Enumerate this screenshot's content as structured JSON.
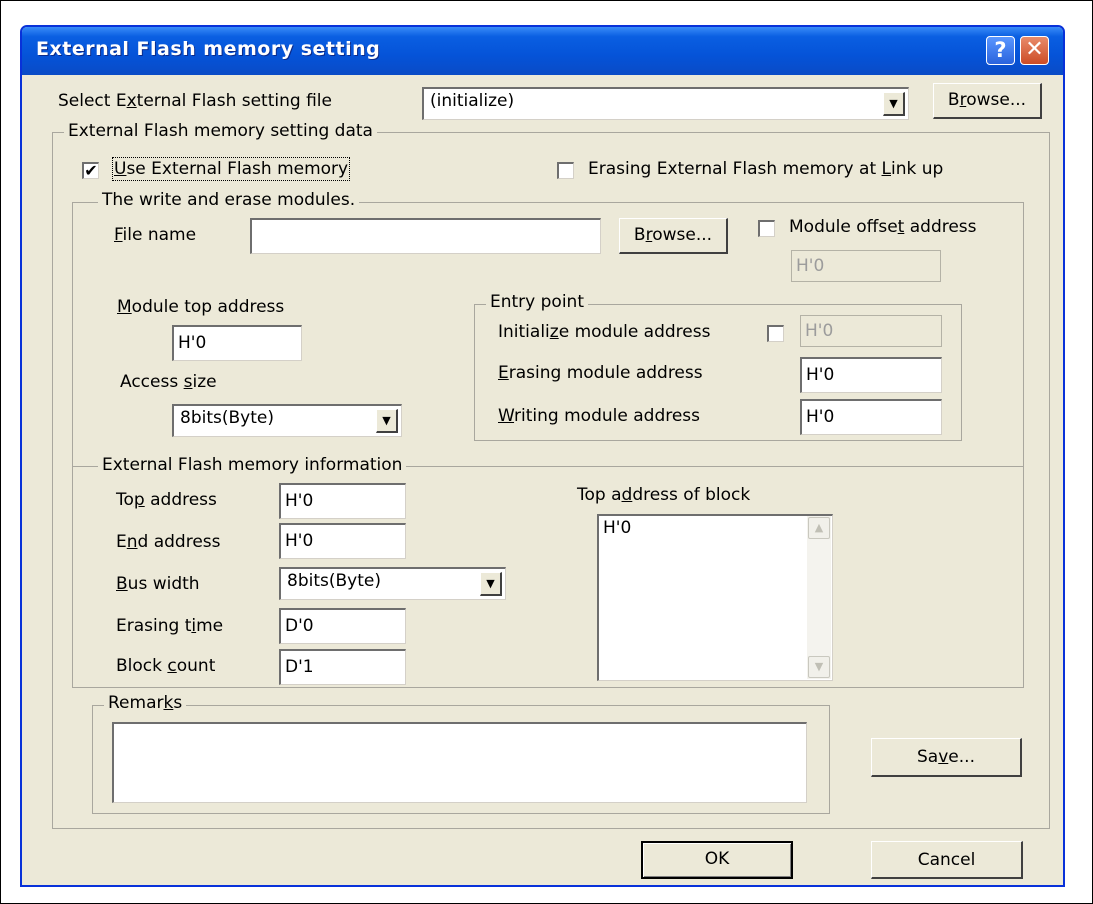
{
  "window": {
    "title": "External Flash memory setting",
    "help_glyph": "?",
    "close_glyph": "✕"
  },
  "setting_file": {
    "label_pre": "Select E",
    "label_key": "x",
    "label_post": "ternal Flash setting file",
    "value": "(initialize)",
    "browse_pre": "B",
    "browse_key": "r",
    "browse_post": "owse..."
  },
  "setting_data": {
    "group_title": "External Flash memory setting data",
    "use_flash": {
      "checked": true,
      "check_glyph": "✔",
      "label_key": "U",
      "label_post": "se External Flash memory"
    },
    "erase_at_linkup": {
      "checked": false,
      "label_pre": "Erasing External Flash memory at ",
      "label_key": "L",
      "label_post": "ink up"
    }
  },
  "modules": {
    "group_title": "The write and erase modules.",
    "file_name_key": "F",
    "file_name_post": "ile name",
    "file_name_value": "",
    "browse_pre": "B",
    "browse_key": "r",
    "browse_post": "owse...",
    "offset": {
      "checked": false,
      "label_pre": "Module offse",
      "label_key": "t",
      "label_post": " address",
      "value": "H'0"
    },
    "top_address": {
      "label_key": "M",
      "label_post": "odule top address",
      "value": "H'0"
    },
    "access_size": {
      "label_pre": "Access ",
      "label_key": "s",
      "label_post": "ize",
      "value": "8bits(Byte)"
    },
    "entry_point": {
      "group_title": "Entry point",
      "initialize": {
        "label_pre": "Initiali",
        "label_key": "z",
        "label_post": "e module address",
        "checked": false,
        "value": "H'0"
      },
      "erasing": {
        "label_key": "E",
        "label_post": "rasing module address",
        "value": "H'0"
      },
      "writing": {
        "label_key": "W",
        "label_post": "riting module address",
        "value": "H'0"
      }
    }
  },
  "info": {
    "group_title": "External Flash memory information",
    "top_address": {
      "label_pre": "To",
      "label_key": "p",
      "label_post": " address",
      "value": "H'0"
    },
    "end_address": {
      "label_pre": "E",
      "label_key": "n",
      "label_post": "d address",
      "value": "H'0"
    },
    "bus_width": {
      "label_key": "B",
      "label_post": "us width",
      "value": "8bits(Byte)"
    },
    "erasing_time": {
      "label_pre": "Erasing t",
      "label_key": "i",
      "label_post": "me",
      "value": "D'0"
    },
    "block_count": {
      "label_pre": "Block ",
      "label_key": "c",
      "label_post": "ount",
      "value": "D'1"
    },
    "block_list": {
      "label_pre": "Top a",
      "label_key": "d",
      "label_post": "dress of block",
      "items": [
        "H'0"
      ]
    }
  },
  "remarks": {
    "label_pre": "Remar",
    "label_key": "k",
    "label_post": "s",
    "value": ""
  },
  "buttons": {
    "save_pre": "Sa",
    "save_key": "v",
    "save_post": "e...",
    "ok": "OK",
    "cancel": "Cancel"
  },
  "icons": {
    "dropdown": "▼",
    "scroll_up": "▲",
    "scroll_down": "▼"
  }
}
